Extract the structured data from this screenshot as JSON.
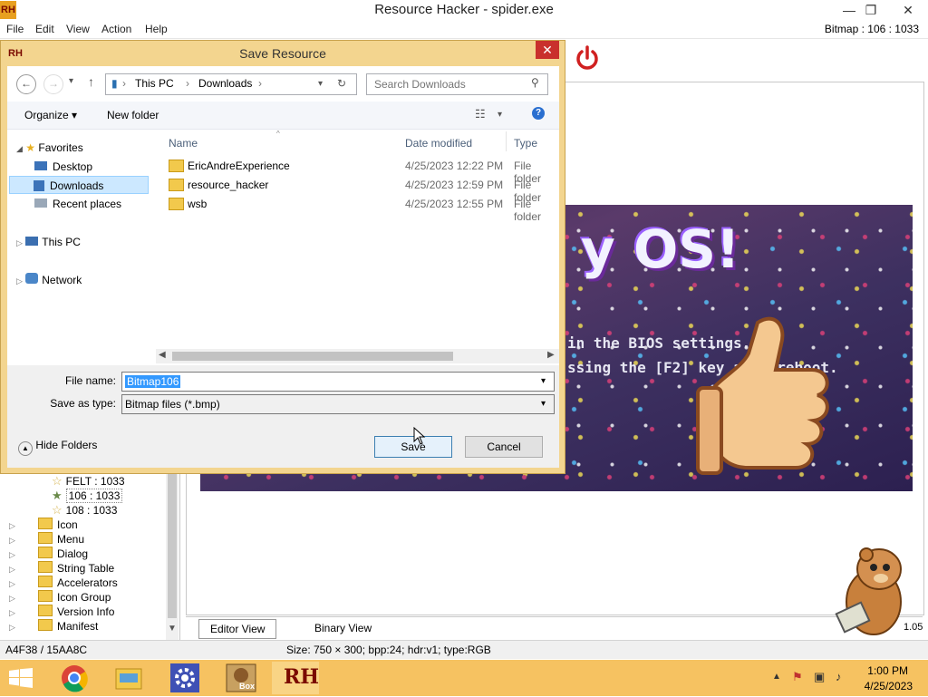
{
  "window": {
    "logo": "RH",
    "title": "Resource Hacker - spider.exe",
    "min": "—",
    "max": "❐",
    "close": "✕",
    "bitmap_info": "Bitmap : 106 : 1033"
  },
  "menu": [
    "File",
    "Edit",
    "View",
    "Action",
    "Help"
  ],
  "bitmap": {
    "logo_text": "y OS!",
    "line1": "in the BIOS settings.",
    "line2": "ssing the [F2] key af   u reboot."
  },
  "tree": {
    "items": [
      {
        "label": "FELT : 1033",
        "kind": "star"
      },
      {
        "label": "106 : 1033",
        "kind": "star-selected"
      },
      {
        "label": "108 : 1033",
        "kind": "star"
      },
      {
        "label": "Icon",
        "kind": "folder"
      },
      {
        "label": "Menu",
        "kind": "folder"
      },
      {
        "label": "Dialog",
        "kind": "folder"
      },
      {
        "label": "String Table",
        "kind": "folder"
      },
      {
        "label": "Accelerators",
        "kind": "folder"
      },
      {
        "label": "Icon Group",
        "kind": "folder"
      },
      {
        "label": "Version Info",
        "kind": "folder"
      },
      {
        "label": "Manifest",
        "kind": "folder"
      }
    ]
  },
  "tabs": {
    "editor": "Editor View",
    "binary": "Binary View",
    "version": "1.05"
  },
  "status": {
    "left": "A4F38 / 15AA8C",
    "right": "Size: 750 × 300;  bpp:24;  hdr:v1;  type:RGB"
  },
  "dialog": {
    "logo": "RH",
    "title": "Save Resource",
    "close": "✕",
    "path": [
      "This PC",
      "Downloads"
    ],
    "search_placeholder": "Search Downloads",
    "organize": "Organize ▾",
    "new_folder": "New folder",
    "nav": {
      "favorites": "Favorites",
      "desktop": "Desktop",
      "downloads": "Downloads",
      "recent": "Recent places",
      "thispc": "This PC",
      "network": "Network"
    },
    "columns": {
      "name": "Name",
      "date": "Date modified",
      "type": "Type"
    },
    "files": [
      {
        "name": "EricAndreExperience",
        "date": "4/25/2023 12:22 PM",
        "type": "File folder"
      },
      {
        "name": "resource_hacker",
        "date": "4/25/2023 12:59 PM",
        "type": "File folder"
      },
      {
        "name": "wsb",
        "date": "4/25/2023 12:55 PM",
        "type": "File folder"
      }
    ],
    "file_name_label": "File name:",
    "file_name_value": "Bitmap106",
    "save_type_label": "Save as type:",
    "save_type_value": "Bitmap files (*.bmp)",
    "hide_folders": "Hide Folders",
    "save": "Save",
    "cancel": "Cancel"
  },
  "taskbar": {
    "time": "1:00 PM",
    "date": "4/25/2023",
    "rh_label": "RH",
    "box_label": "Box"
  },
  "colors": {
    "dialog_frame": "#f3d58f",
    "taskbar": "#f6c261",
    "selection": "#3399ff"
  }
}
